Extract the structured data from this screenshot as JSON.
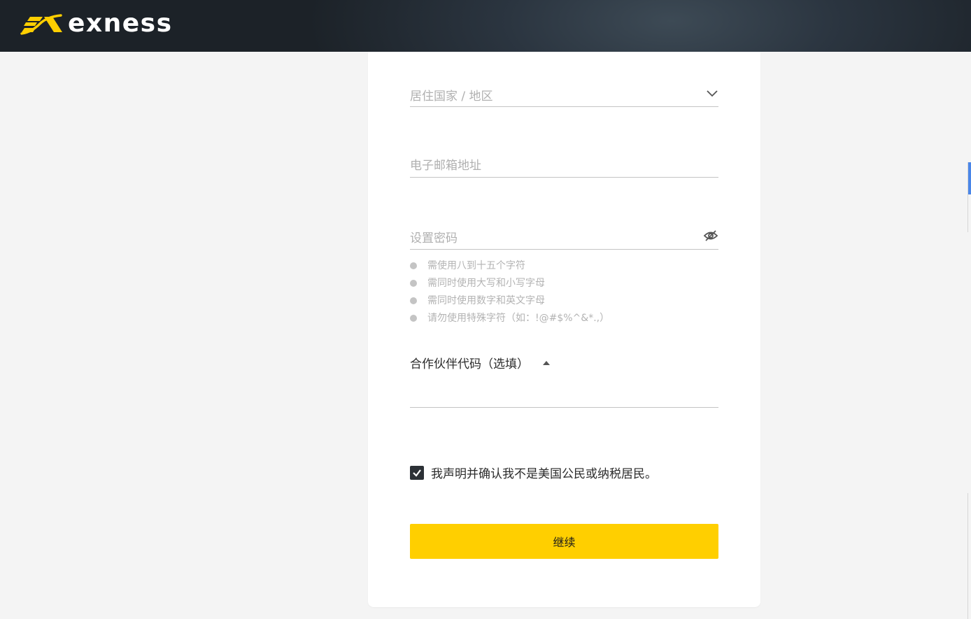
{
  "header": {
    "brand_name": "exness",
    "background": "#1c2228",
    "logo_mark_color": "#ffcf00"
  },
  "form": {
    "country": {
      "placeholder": "居住国家 / 地区",
      "icon": "chevron-down-icon"
    },
    "email": {
      "placeholder": "电子邮箱地址"
    },
    "password": {
      "placeholder": "设置密码",
      "icon": "eye-off-icon",
      "rules": [
        "需使用八到十五个字符",
        "需同时使用大写和小写字母",
        "需同时使用数字和英文字母",
        "请勿使用特殊字符（如：!@#$%^&*.,）"
      ]
    },
    "partner": {
      "label": "合作伙伴代码（选填）",
      "icon": "caret-up-icon",
      "value": ""
    },
    "declaration": {
      "text": "我声明并确认我不是美国公民或纳税居民。",
      "checked": true
    },
    "continue_label": "继续",
    "accent": "#ffcf00"
  }
}
